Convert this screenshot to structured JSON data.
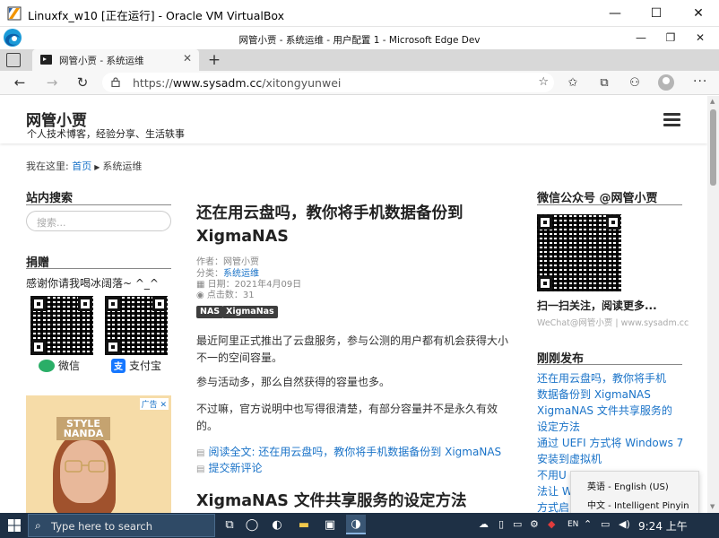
{
  "vbox": {
    "title": "Linuxfx_w10 [正在运行] - Oracle VM VirtualBox",
    "minimize": "—",
    "maximize": "☐",
    "close": "✕"
  },
  "edge": {
    "window_title": "网管小贾 - 系统运维 - 用户配置 1 - Microsoft Edge Dev",
    "tab_label": "网管小贾 - 系统运维",
    "tab_close": "✕",
    "new_tab": "+",
    "url_scheme": "https://",
    "url_host": "www.sysadm.cc",
    "url_path": "/xitongyunwei",
    "back": "←",
    "forward": "→",
    "refresh": "↻",
    "more": "···"
  },
  "site": {
    "name": "网管小贾",
    "tagline": "个人技术博客，经验分享、生活轶事",
    "breadcrumb_prefix": "我在这里:",
    "breadcrumb_home": "首页",
    "breadcrumb_current": "系统运维"
  },
  "sidebar_left": {
    "search_title": "站内搜索",
    "search_placeholder": "搜索...",
    "donate_title": "捐赠",
    "donate_text": "感谢你请我喝冰阔落~ ^_^",
    "wechat_label": "微信",
    "alipay_label": "支付宝",
    "alipay_glyph": "支",
    "ad_brand": "STYLE NANDA",
    "ad_badge": "广告 ✕"
  },
  "post": {
    "title": "还在用云盘吗，教你将手机数据备份到 XigmaNAS",
    "author_label": "作者：",
    "author": "网管小贾",
    "category_label": "分类：",
    "category": "系统运维",
    "date_label": "日期：",
    "date": "2021年4月09日",
    "views_label": "点击数：",
    "views": "31",
    "tags": [
      "NAS",
      "XigmaNas"
    ],
    "p1": "最近阿里正式推出了云盘服务，参与公测的用户都有机会获得大小不一的空间容量。",
    "p2": "参与活动多，那么自然获得的容量也多。",
    "p3": "不过嘛，官方说明中也写得很清楚，有部分容量并不是永久有效的。",
    "read_more": "阅读全文: 还在用云盘吗，教你将手机数据备份到 XigmaNAS",
    "comment": "提交新评论",
    "next_title": "XigmaNAS 文件共享服务的设定方法"
  },
  "sidebar_right": {
    "wechat_title": "微信公众号 @网管小贾",
    "scan_caption": "扫一扫关注，阅读更多...",
    "scan_sub": "WeChat@网管小贾 | www.sysadm.cc",
    "recent_title": "刚刚发布",
    "recent": [
      "还在用云盘吗，教你将手机",
      "数据备份到 XigmaNAS",
      "XigmaNAS 文件共享服务的",
      "设定方法",
      "通过 UEFI 方式将 Windows 7",
      "安装到虚拟机",
      "不用U",
      "法让 W",
      "方式启"
    ]
  },
  "ime": {
    "option_1": "英语 - English (US)",
    "option_2": "中文 - Intelligent Pinyin"
  },
  "taskbar": {
    "search_placeholder": "Type here to search",
    "lang": "EN",
    "time": "9:24 上午"
  }
}
